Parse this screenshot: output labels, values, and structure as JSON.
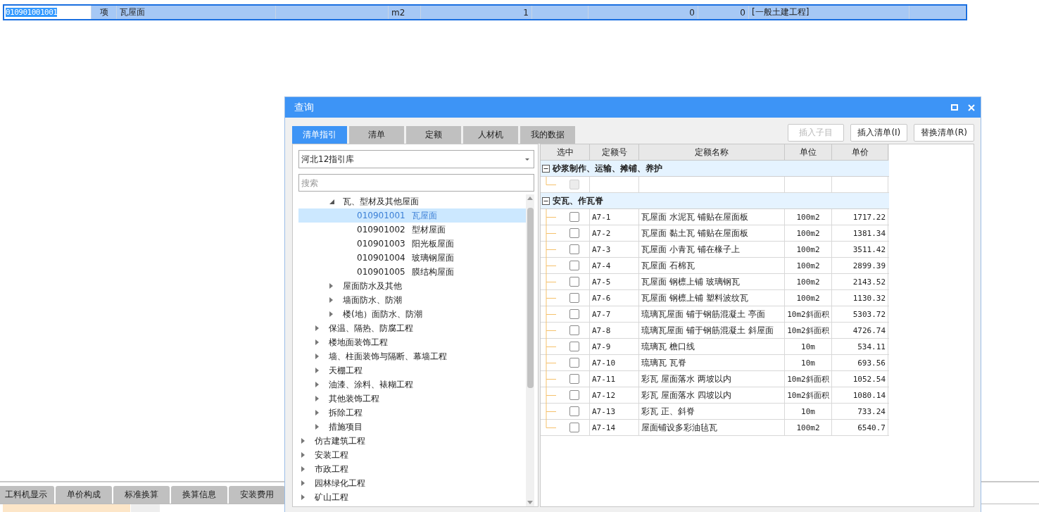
{
  "bill_row": {
    "selected": true,
    "code": "010901001001",
    "type": "项",
    "name": "瓦屋面",
    "unit": "m2",
    "quantity": "1",
    "column_8": "0",
    "column_9": "0",
    "column_10": "[一般土建工程]"
  },
  "bottom_tabs": [
    {
      "label": "工料机显示",
      "selected": false
    },
    {
      "label": "单价构成",
      "selected": false
    },
    {
      "label": "标准换算",
      "selected": false
    },
    {
      "label": "换算信息",
      "selected": false
    },
    {
      "label": "安装费用",
      "selected": false
    }
  ],
  "dialog": {
    "title": "查询",
    "tabs": [
      {
        "label": "清单指引",
        "selected": true
      },
      {
        "label": "清单",
        "selected": false
      },
      {
        "label": "定额",
        "selected": false
      },
      {
        "label": "人材机",
        "selected": false
      },
      {
        "label": "我的数据",
        "selected": false
      }
    ],
    "buttons": [
      {
        "label": "插入子目",
        "disabled": true
      },
      {
        "label": "插入清单(I)",
        "disabled": false
      },
      {
        "label": "替换清单(R)",
        "disabled": false
      }
    ],
    "library": {
      "value": "河北12指引库"
    },
    "search": {
      "placeholder": "搜索"
    },
    "tree": [
      {
        "children": [
          {
            "children": [
              {
                "label": "瓦、型材及其他屋面",
                "expanded": true,
                "selected": false,
                "children": [
                  {
                    "code": "010901001",
                    "label": "瓦屋面",
                    "selected": true
                  },
                  {
                    "code": "010901002",
                    "label": "型材屋面",
                    "selected": false
                  },
                  {
                    "code": "010901003",
                    "label": "阳光板屋面",
                    "selected": false
                  },
                  {
                    "code": "010901004",
                    "label": "玻璃钢屋面",
                    "selected": false
                  },
                  {
                    "code": "010901005",
                    "label": "膜结构屋面",
                    "selected": false
                  }
                ]
              },
              {
                "label": "屋面防水及其他",
                "expanded": false,
                "selected": false
              },
              {
                "label": "墙面防水、防潮",
                "expanded": false,
                "selected": false
              },
              {
                "label": "楼(地）面防水、防潮",
                "expanded": false,
                "selected": false
              }
            ]
          },
          {
            "label": "保温、隔热、防腐工程",
            "expanded": false,
            "selected": false
          },
          {
            "label": "楼地面装饰工程",
            "expanded": false,
            "selected": false
          },
          {
            "label": "墙、柱面装饰与隔断、幕墙工程",
            "expanded": false,
            "selected": false
          },
          {
            "label": "天棚工程",
            "expanded": false,
            "selected": false
          },
          {
            "label": "油漆、涂料、裱糊工程",
            "expanded": false,
            "selected": false
          },
          {
            "label": "其他装饰工程",
            "expanded": false,
            "selected": false
          },
          {
            "label": "拆除工程",
            "expanded": false,
            "selected": false
          },
          {
            "label": "措施项目",
            "expanded": false,
            "selected": false
          }
        ]
      },
      {
        "label": "仿古建筑工程",
        "expanded": false,
        "selected": false
      },
      {
        "label": "安装工程",
        "expanded": false,
        "selected": false
      },
      {
        "label": "市政工程",
        "expanded": false,
        "selected": false
      },
      {
        "label": "园林绿化工程",
        "expanded": false,
        "selected": false
      },
      {
        "label": "矿山工程",
        "expanded": false,
        "selected": false
      }
    ],
    "table": {
      "columns": [
        "选中",
        "定额号",
        "定额名称",
        "单位",
        "单价"
      ],
      "groups": [
        {
          "title": "砂浆制作、运输、摊铺、养护",
          "expanded": true,
          "rows": [
            {
              "checked": false,
              "disabled": true
            }
          ]
        },
        {
          "title": "安瓦、作瓦脊",
          "expanded": true,
          "rows": [
            {
              "checked": false,
              "disabled": false,
              "code": "A7-1",
              "name": "瓦屋面 水泥瓦 铺贴在屋面板",
              "unit": "100m2",
              "price": "1717.22"
            },
            {
              "checked": false,
              "disabled": false,
              "code": "A7-2",
              "name": "瓦屋面 黏土瓦 铺贴在屋面板",
              "unit": "100m2",
              "price": "1381.34"
            },
            {
              "checked": false,
              "disabled": false,
              "code": "A7-3",
              "name": "瓦屋面 小青瓦 铺在椽子上",
              "unit": "100m2",
              "price": "3511.42"
            },
            {
              "checked": false,
              "disabled": false,
              "code": "A7-4",
              "name": "瓦屋面 石棉瓦",
              "unit": "100m2",
              "price": "2899.39"
            },
            {
              "checked": false,
              "disabled": false,
              "code": "A7-5",
              "name": "瓦屋面 钢檩上铺 玻璃钢瓦",
              "unit": "100m2",
              "price": "2143.52"
            },
            {
              "checked": false,
              "disabled": false,
              "code": "A7-6",
              "name": "瓦屋面 钢檩上铺 塑料波纹瓦",
              "unit": "100m2",
              "price": "1130.32"
            },
            {
              "checked": false,
              "disabled": false,
              "code": "A7-7",
              "name": "琉璃瓦屋面 铺于钢筋混凝土 亭面",
              "unit": "10m2斜面积",
              "price": "5303.72"
            },
            {
              "checked": false,
              "disabled": false,
              "code": "A7-8",
              "name": "琉璃瓦屋面 铺于钢筋混凝土 斜屋面",
              "unit": "10m2斜面积",
              "price": "4726.74"
            },
            {
              "checked": false,
              "disabled": false,
              "code": "A7-9",
              "name": "琉璃瓦 檐口线",
              "unit": "10m",
              "price": "534.11"
            },
            {
              "checked": false,
              "disabled": false,
              "code": "A7-10",
              "name": "琉璃瓦 瓦脊",
              "unit": "10m",
              "price": "693.56"
            },
            {
              "checked": false,
              "disabled": false,
              "code": "A7-11",
              "name": "彩瓦 屋面落水 两坡以内",
              "unit": "10m2斜面积",
              "price": "1052.54"
            },
            {
              "checked": false,
              "disabled": false,
              "code": "A7-12",
              "name": "彩瓦 屋面落水 四坡以内",
              "unit": "10m2斜面积",
              "price": "1080.14"
            },
            {
              "checked": false,
              "disabled": false,
              "code": "A7-13",
              "name": "彩瓦 正、斜脊",
              "unit": "10m",
              "price": "733.24"
            },
            {
              "checked": false,
              "disabled": false,
              "code": "A7-14",
              "name": "屋面铺设多彩油毡瓦",
              "unit": "100m2",
              "price": "6540.7"
            }
          ]
        }
      ]
    }
  }
}
